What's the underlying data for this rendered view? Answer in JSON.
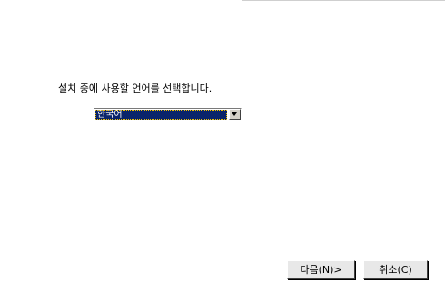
{
  "dialog": {
    "prompt": "설치 중에 사용할 언어를 선택합니다.",
    "language_select": {
      "selected": "한국어"
    },
    "buttons": {
      "next_label": "다음(N)>",
      "cancel_label": "취소(C)"
    }
  }
}
